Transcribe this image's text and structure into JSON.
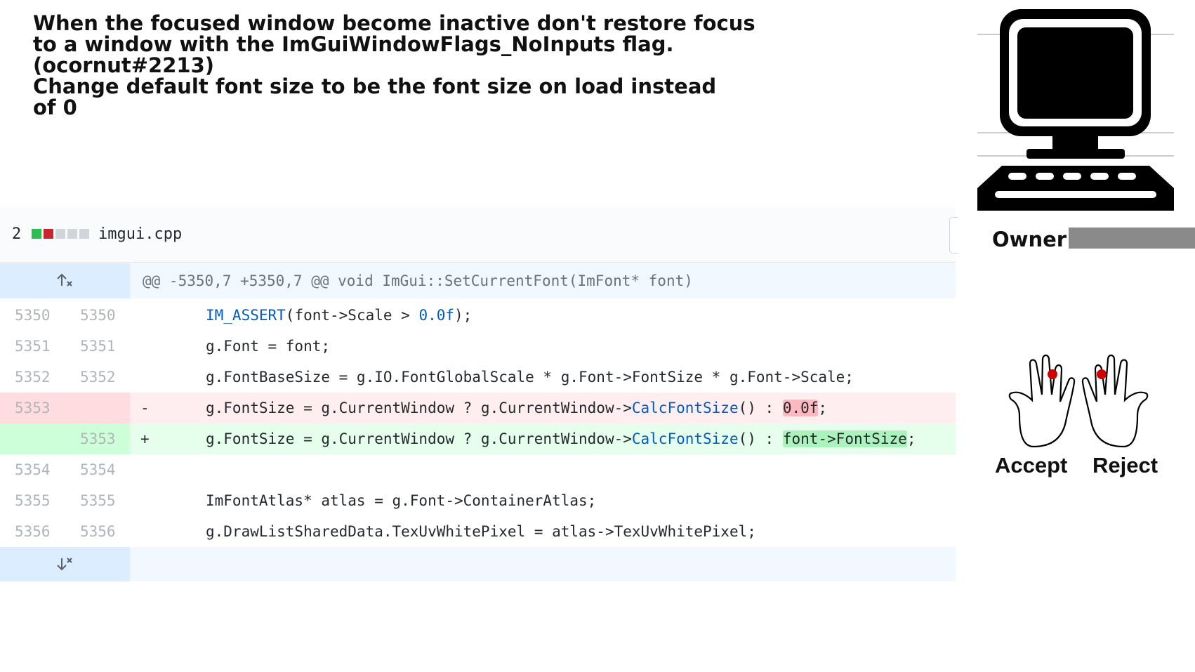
{
  "commit_message": {
    "lines": [
      "When the focused window become inactive don't restore focus",
      "to a window with the ImGuiWindowFlags_NoInputs flag.",
      "(ocornut#2213)",
      "Change default font size to be the font size on load instead",
      "of 0"
    ]
  },
  "file_header": {
    "change_count": "2",
    "filename": "imgui.cpp",
    "diffstat_colors": [
      "#2cbe4e",
      "#cb2431",
      "#d1d5da",
      "#d1d5da",
      "#d1d5da"
    ]
  },
  "hunk": {
    "header": "@@ -5350,7 +5350,7 @@ void ImGui::SetCurrentFont(ImFont* font)",
    "expand_icon": "expand-up-icon",
    "expand_bottom_icon": "expand-down-icon"
  },
  "lines": [
    {
      "old": "5350",
      "new": "5350",
      "sign": "",
      "type": "context",
      "code_pre": "IM_ASSERT",
      "code_post": "(font->Scale > ",
      "code_num": "0.0f",
      "code_end": ");"
    },
    {
      "old": "5351",
      "new": "5351",
      "sign": "",
      "type": "context",
      "code": "g.Font = font;"
    },
    {
      "old": "5352",
      "new": "5352",
      "sign": "",
      "type": "context",
      "code": "g.FontBaseSize = g.IO.FontGlobalScale * g.Font->FontSize * g.Font->Scale;"
    },
    {
      "old": "5353",
      "new": "",
      "sign": "-",
      "type": "deletion",
      "code_pre": "g.FontSize = g.CurrentWindow ? g.CurrentWindow->",
      "code_fn": "CalcFontSize",
      "code_mid": "() : ",
      "code_hl": "0.0f",
      "code_end": ";"
    },
    {
      "old": "",
      "new": "5353",
      "sign": "+",
      "type": "addition",
      "code_pre": "g.FontSize = g.CurrentWindow ? g.CurrentWindow->",
      "code_fn": "CalcFontSize",
      "code_mid": "() : ",
      "code_hl": "font->FontSize",
      "code_end": ";"
    },
    {
      "old": "5354",
      "new": "5354",
      "sign": "",
      "type": "context",
      "code": ""
    },
    {
      "old": "5355",
      "new": "5355",
      "sign": "",
      "type": "context",
      "code": "ImFontAtlas* atlas = g.Font->ContainerAtlas;"
    },
    {
      "old": "5356",
      "new": "5356",
      "sign": "",
      "type": "context",
      "code": "g.DrawListSharedData.TexUvWhitePixel = atlas->TexUvWhitePixel;"
    }
  ],
  "sidebar": {
    "computer_icon": "computer-icon",
    "owner_label": "Owner:",
    "owner_value_redacted": true,
    "accept_label": "Accept",
    "reject_label": "Reject",
    "hand_icon": "hand-icon",
    "marker_color": "#cc0000"
  }
}
